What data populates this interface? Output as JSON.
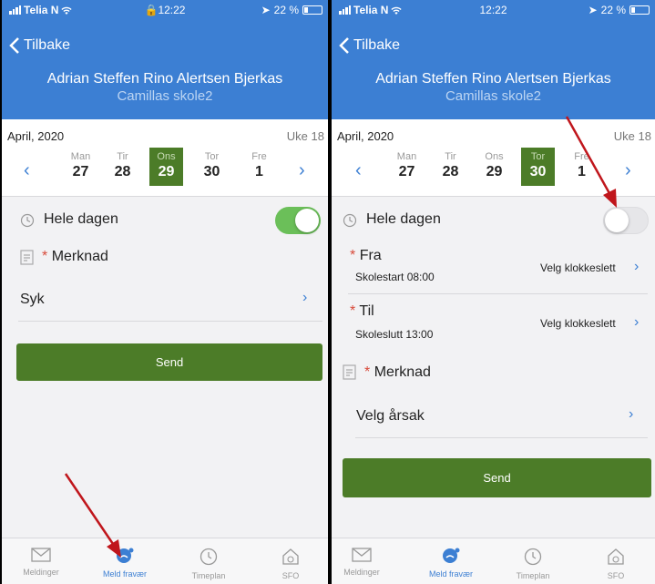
{
  "status": {
    "left": {
      "carrier": "Telia N",
      "time": "12:22",
      "battery": "22 %"
    },
    "right": {
      "carrier": "Telia N",
      "time": "12:22",
      "battery": "22 %"
    }
  },
  "header": {
    "back_label": "Tilbake",
    "student_name": "Adrian Steffen Rino Alertsen Bjerkas",
    "school": "Camillas skole2"
  },
  "calendar": {
    "month": "April, 2020",
    "week": "Uke 18",
    "days": [
      {
        "name": "Man",
        "date": "27"
      },
      {
        "name": "Tir",
        "date": "28"
      },
      {
        "name": "Ons",
        "date": "29"
      },
      {
        "name": "Tor",
        "date": "30"
      },
      {
        "name": "Fre",
        "date": "1"
      }
    ],
    "prev_glyph": "‹",
    "next_glyph": "›"
  },
  "form_left": {
    "whole_day_label": "Hele dagen",
    "whole_day_on": true,
    "note_star": "*",
    "note_label": "Merknad",
    "reason_value": "Syk",
    "send_label": "Send"
  },
  "form_right": {
    "whole_day_label": "Hele dagen",
    "whole_day_on": false,
    "from_star": "*",
    "from_label": "Fra",
    "from_sub": "Skolestart 08:00",
    "from_action": "Velg klokkeslett",
    "to_star": "*",
    "to_label": "Til",
    "to_sub": "Skoleslutt 13:00",
    "to_action": "Velg klokkeslett",
    "note_star": "*",
    "note_label": "Merknad",
    "reason_value": "Velg årsak",
    "send_label": "Send"
  },
  "tabs": [
    {
      "label": "Meldinger",
      "icon": "mail-icon"
    },
    {
      "label": "Meld fravær",
      "icon": "report-absence-icon"
    },
    {
      "label": "Timeplan",
      "icon": "clock-icon"
    },
    {
      "label": "SFO",
      "icon": "home-icon"
    }
  ],
  "colors": {
    "header": "#3c7fd3",
    "accent_green": "#4c7c28",
    "toggle_on": "#6bbf59",
    "annotation_arrow": "#c0161c"
  }
}
